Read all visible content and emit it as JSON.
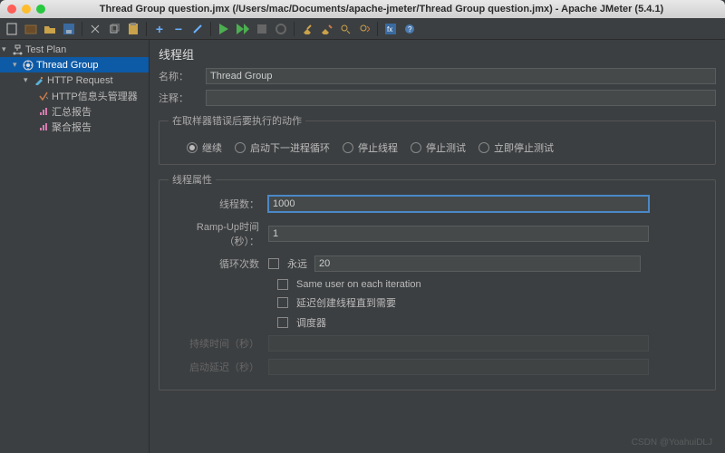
{
  "window": {
    "title": "Thread Group question.jmx (/Users/mac/Documents/apache-jmeter/Thread Group question.jmx) - Apache JMeter (5.4.1)"
  },
  "tree": {
    "root": "Test Plan",
    "items": [
      {
        "label": "Thread Group"
      },
      {
        "label": "HTTP Request"
      },
      {
        "label": "HTTP信息头管理器"
      },
      {
        "label": "汇总报告"
      },
      {
        "label": "聚合报告"
      }
    ]
  },
  "panel": {
    "title": "线程组",
    "name_label": "名称：",
    "name_value": "Thread Group",
    "comment_label": "注释：",
    "comment_value": "",
    "error_fieldset": "在取样器错误后要执行的动作",
    "radios": {
      "continue": "继续",
      "startNext": "启动下一进程循环",
      "stopThread": "停止线程",
      "stopTest": "停止测试",
      "stopTestNow": "立即停止测试"
    },
    "props_fieldset": "线程属性",
    "threads_label": "线程数：",
    "threads_value": "1000",
    "rampup_label": "Ramp-Up时间（秒）：",
    "rampup_value": "1",
    "loop_label": "循环次数",
    "forever_label": "永远",
    "loop_value": "20",
    "same_user": "Same user on each iteration",
    "delay_create": "延迟创建线程直到需要",
    "scheduler": "调度器",
    "duration_label": "持续时间（秒）",
    "startup_label": "启动延迟（秒）"
  },
  "watermark": "CSDN @YoahuiDLJ"
}
